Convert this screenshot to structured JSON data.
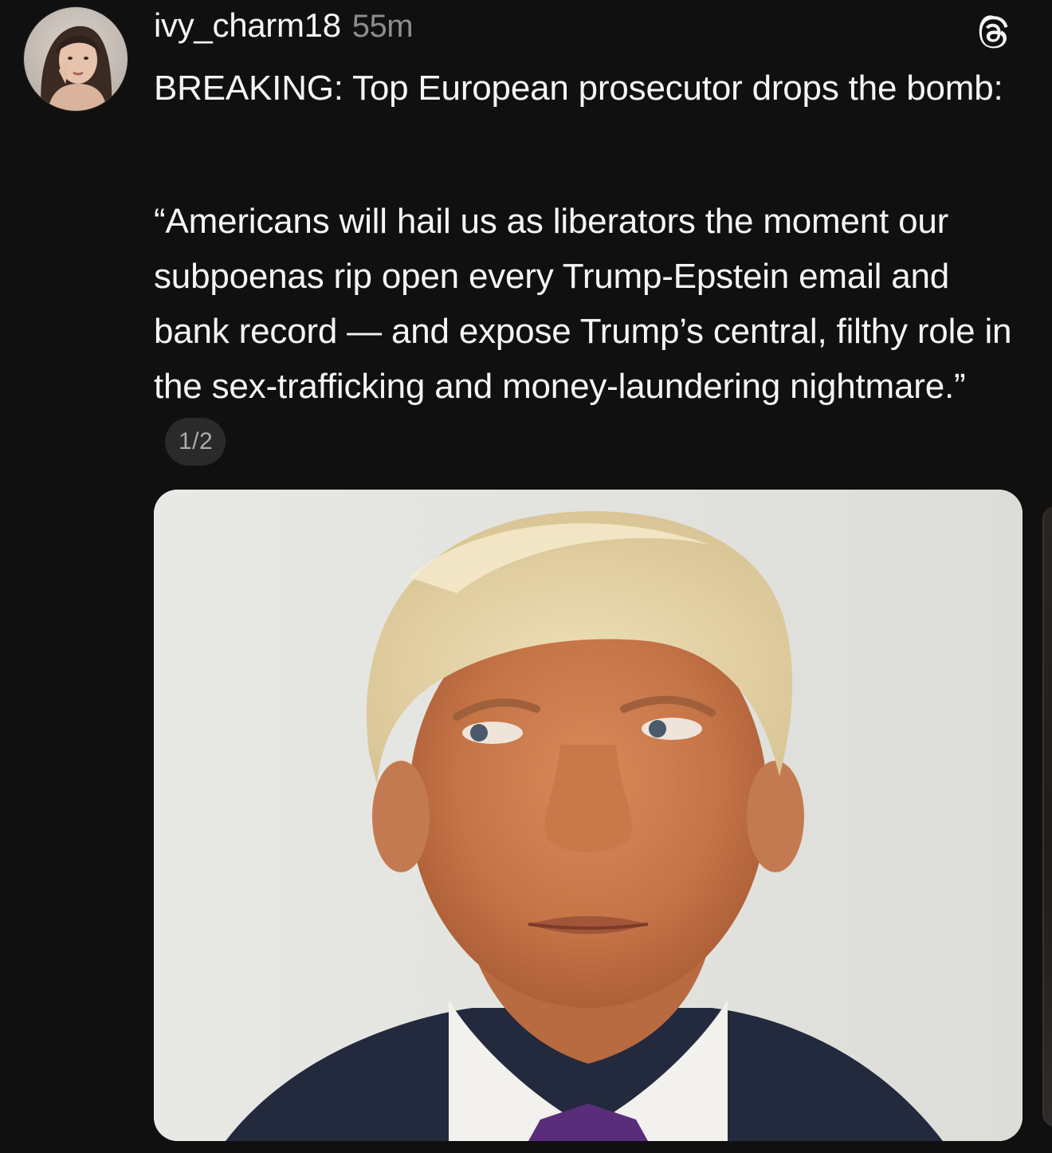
{
  "post": {
    "author": {
      "username": "ivy_charm18",
      "timestamp": "55m",
      "avatar_icon": "profile-avatar"
    },
    "app_logo_icon": "threads-logo-icon",
    "text": {
      "paragraph1": "BREAKING: Top European prosecutor drops the bomb:",
      "paragraph2": "“Americans will hail us as liberators the moment our subpoenas rip open every Trump-Epstein email and bank record — and expose Trump’s central, filthy role in the sex-trafficking and money-laundering nightmare.”"
    },
    "media": {
      "page_indicator": "1/2",
      "current_index": 1,
      "total": 2
    }
  },
  "colors": {
    "background": "#101010",
    "text_primary": "#f3f5f7",
    "text_secondary": "#8a8d91",
    "badge_background": "#2a2a2a"
  }
}
